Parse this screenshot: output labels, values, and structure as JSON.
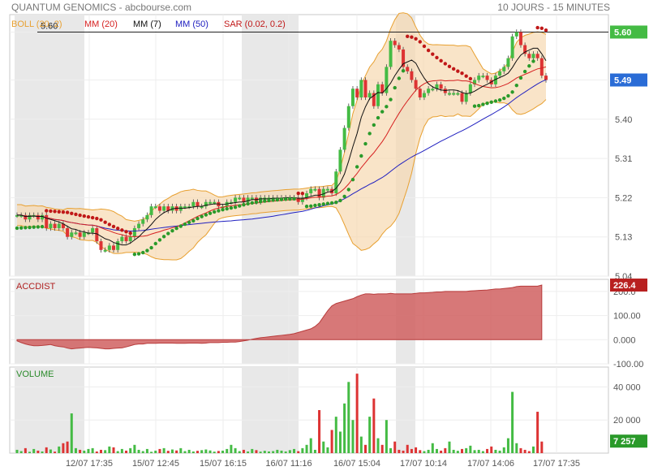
{
  "header": {
    "title": "QUANTUM GENOMICS - abcbourse.com",
    "period": "10 JOURS - 15 MINUTES"
  },
  "legend": [
    {
      "label": "BOLL (20, 2)",
      "color": "#e8a030"
    },
    {
      "label": "MM (20)",
      "color": "#d62020"
    },
    {
      "label": "MM (7)",
      "color": "#111111"
    },
    {
      "label": "MM (50)",
      "color": "#2020c0"
    },
    {
      "label": "SAR (0.02, 0.2)",
      "color": "#c01818"
    }
  ],
  "colors": {
    "up": "#44bb44",
    "down": "#dd3333",
    "boll_fill": "#f7d9b0",
    "boll_line": "#e8a030",
    "shade": "#e8e8e8",
    "accdist": "#d06060"
  },
  "chart_data": [
    {
      "type": "candlestick",
      "title": "",
      "x_tick_labels": [
        "12/07 17:35",
        "15/07 12:45",
        "15/07 16:15",
        "16/07 11:16",
        "16/07 15:04",
        "17/07 10:14",
        "17/07 14:06",
        "17/07 17:35"
      ],
      "y_ticks": [
        "5.60",
        "5.49",
        "5.40",
        "5.31",
        "5.22",
        "5.13",
        "5.04"
      ],
      "ylim": [
        5.04,
        5.64
      ],
      "reference_line": {
        "label": "5.60",
        "value": 5.6
      },
      "last_badges": [
        {
          "label": "5.60",
          "value": 5.6,
          "color": "#44bb44"
        },
        {
          "label": "5.49",
          "value": 5.49,
          "color": "#2a6cd6"
        }
      ],
      "close": [
        5.18,
        5.18,
        5.17,
        5.18,
        5.18,
        5.17,
        5.18,
        5.15,
        5.16,
        5.15,
        5.16,
        5.15,
        5.13,
        5.14,
        5.14,
        5.13,
        5.14,
        5.14,
        5.15,
        5.12,
        5.1,
        5.1,
        5.11,
        5.1,
        5.12,
        5.13,
        5.12,
        5.13,
        5.15,
        5.16,
        5.17,
        5.18,
        5.2,
        5.2,
        5.19,
        5.2,
        5.19,
        5.2,
        5.19,
        5.2,
        5.2,
        5.2,
        5.21,
        5.2,
        5.2,
        5.21,
        5.21,
        5.21,
        5.2,
        5.2,
        5.21,
        5.21,
        5.22,
        5.22,
        5.21,
        5.22,
        5.22,
        5.21,
        5.22,
        5.22,
        5.22,
        5.22,
        5.22,
        5.22,
        5.22,
        5.22,
        5.22,
        5.21,
        5.22,
        5.23,
        5.24,
        5.24,
        5.22,
        5.24,
        5.24,
        5.23,
        5.28,
        5.33,
        5.38,
        5.43,
        5.47,
        5.45,
        5.49,
        5.45,
        5.46,
        5.43,
        5.48,
        5.46,
        5.52,
        5.58,
        5.57,
        5.56,
        5.52,
        5.51,
        5.49,
        5.47,
        5.45,
        5.46,
        5.47,
        5.47,
        5.48,
        5.47,
        5.46,
        5.46,
        5.46,
        5.46,
        5.44,
        5.46,
        5.48,
        5.49,
        5.5,
        5.5,
        5.49,
        5.48,
        5.5,
        5.51,
        5.52,
        5.54,
        5.59,
        5.6,
        5.57,
        5.55,
        5.54,
        5.55,
        5.54,
        5.5,
        5.49
      ],
      "open": [
        5.18,
        5.18,
        5.18,
        5.17,
        5.18,
        5.18,
        5.17,
        5.18,
        5.15,
        5.16,
        5.15,
        5.16,
        5.15,
        5.13,
        5.14,
        5.14,
        5.13,
        5.14,
        5.14,
        5.15,
        5.12,
        5.1,
        5.1,
        5.11,
        5.1,
        5.12,
        5.13,
        5.12,
        5.13,
        5.15,
        5.16,
        5.17,
        5.18,
        5.2,
        5.2,
        5.19,
        5.2,
        5.19,
        5.2,
        5.19,
        5.2,
        5.2,
        5.2,
        5.21,
        5.2,
        5.2,
        5.21,
        5.21,
        5.21,
        5.2,
        5.2,
        5.21,
        5.21,
        5.22,
        5.22,
        5.21,
        5.22,
        5.22,
        5.21,
        5.22,
        5.22,
        5.22,
        5.22,
        5.22,
        5.22,
        5.22,
        5.22,
        5.22,
        5.21,
        5.22,
        5.23,
        5.24,
        5.24,
        5.22,
        5.24,
        5.24,
        5.23,
        5.28,
        5.33,
        5.38,
        5.43,
        5.47,
        5.45,
        5.49,
        5.45,
        5.46,
        5.43,
        5.48,
        5.46,
        5.52,
        5.58,
        5.57,
        5.56,
        5.52,
        5.51,
        5.49,
        5.47,
        5.45,
        5.46,
        5.47,
        5.47,
        5.48,
        5.47,
        5.46,
        5.46,
        5.46,
        5.46,
        5.44,
        5.46,
        5.48,
        5.49,
        5.5,
        5.5,
        5.49,
        5.48,
        5.5,
        5.51,
        5.52,
        5.54,
        5.59,
        5.6,
        5.57,
        5.55,
        5.54,
        5.55,
        5.54,
        5.5
      ],
      "volume_ylim": [
        0,
        52000
      ],
      "volume_ticks": [
        "40 000",
        "20 000"
      ],
      "volume_badge": {
        "label": "7 257",
        "value": 7257
      },
      "volume": [
        2000,
        1200,
        3000,
        800,
        2500,
        1500,
        1000,
        3500,
        2200,
        900,
        4000,
        6000,
        7000,
        24000,
        3000,
        2000,
        1500,
        2500,
        3000,
        1000,
        2000,
        1800,
        4000,
        3500,
        1200,
        2500,
        1500,
        3000,
        5000,
        2000,
        1200,
        2500,
        800,
        1500,
        2500,
        3000,
        1400,
        2200,
        1600,
        3000,
        1200,
        2000,
        1000,
        1400,
        1800,
        2200,
        1600,
        900,
        1300,
        1500,
        2500,
        5000,
        3000,
        1200,
        2000,
        1000,
        2500,
        1800,
        900,
        1400,
        1000,
        1200,
        2000,
        1500,
        1000,
        1800,
        2500,
        1200,
        3000,
        5000,
        9000,
        2000,
        26000,
        7000,
        3500,
        14000,
        22000,
        13000,
        30000,
        43000,
        20000,
        48000,
        10000,
        5000,
        22000,
        33000,
        9000,
        5000,
        20000,
        3000,
        7000,
        2000,
        1500,
        5000,
        2500,
        3500,
        1800,
        1200,
        2000,
        6000,
        2500,
        1500,
        3000,
        7000,
        2000,
        1400,
        2500,
        3000,
        4500,
        1800,
        2000,
        1200,
        2500,
        4000,
        2000,
        1500,
        3500,
        9000,
        37000,
        6000,
        3000,
        2000,
        1200,
        4000,
        25000,
        7000
      ]
    },
    {
      "type": "area",
      "title": "ACCDIST",
      "y_ticks": [
        "200.0",
        "100.00",
        "0.000",
        "-100.00"
      ],
      "ylim": [
        -100,
        250
      ],
      "last_badge": {
        "label": "226.4",
        "value": 226.4
      },
      "values": [
        -5,
        -12,
        -18,
        -22,
        -25,
        -25,
        -24,
        -22,
        -20,
        -25,
        -28,
        -30,
        -35,
        -38,
        -36,
        -35,
        -33,
        -32,
        -33,
        -34,
        -36,
        -38,
        -38,
        -36,
        -35,
        -34,
        -30,
        -25,
        -20,
        -18,
        -18,
        -15,
        -15,
        -15,
        -14,
        -14,
        -14,
        -14,
        -15,
        -15,
        -15,
        -14,
        -14,
        -14,
        -15,
        -14,
        -12,
        -12,
        -12,
        -11,
        -11,
        -10,
        -10,
        -8,
        -5,
        -2,
        2,
        5,
        8,
        10,
        12,
        14,
        16,
        18,
        20,
        22,
        25,
        30,
        35,
        40,
        45,
        55,
        70,
        95,
        120,
        140,
        150,
        155,
        160,
        165,
        170,
        178,
        185,
        190,
        190,
        188,
        190,
        190,
        190,
        192,
        190,
        190,
        190,
        190,
        190,
        192,
        194,
        194,
        195,
        196,
        198,
        198,
        200,
        200,
        200,
        200,
        200,
        200,
        202,
        203,
        204,
        205,
        206,
        208,
        210,
        210,
        212,
        214,
        216,
        220,
        222,
        222,
        222,
        222,
        222,
        226.4
      ]
    }
  ]
}
